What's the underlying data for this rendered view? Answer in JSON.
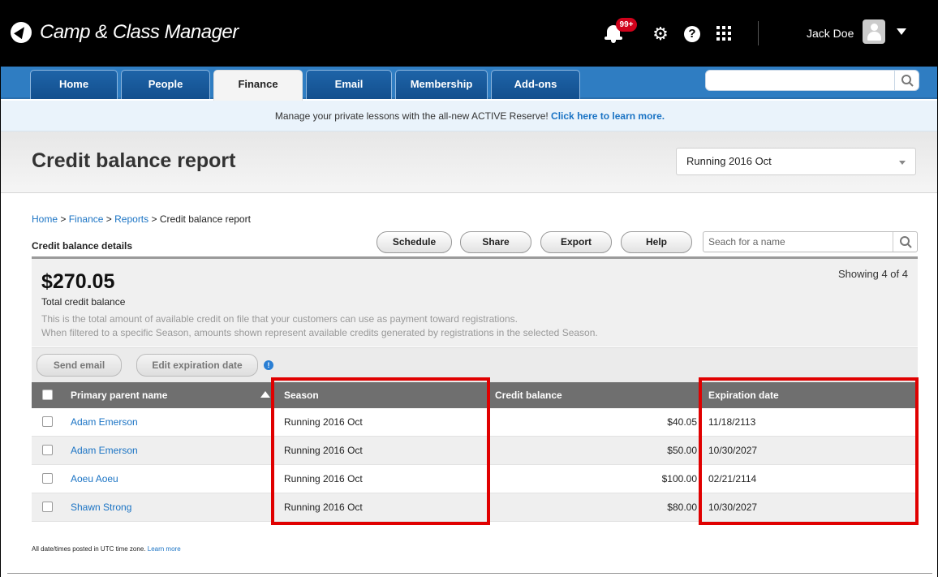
{
  "app": {
    "title": "Camp & Class Manager",
    "notification_badge": "99+",
    "username": "Jack Doe"
  },
  "nav": {
    "tabs": [
      {
        "label": "Home"
      },
      {
        "label": "People"
      },
      {
        "label": "Finance",
        "active": true
      },
      {
        "label": "Email"
      },
      {
        "label": "Membership"
      },
      {
        "label": "Add-ons"
      }
    ],
    "search_value": ""
  },
  "banner": {
    "text": "Manage your private lessons with the all-new ACTIVE Reserve!",
    "link": "Click here to learn more."
  },
  "page": {
    "title": "Credit balance report",
    "season_selected": "Running 2016 Oct"
  },
  "breadcrumb": {
    "home": "Home",
    "finance": "Finance",
    "reports": "Reports",
    "current": "Credit balance report",
    "sep": ">"
  },
  "section": {
    "title": "Credit balance details",
    "buttons": {
      "schedule": "Schedule",
      "share": "Share",
      "export": "Export",
      "help": "Help"
    },
    "search_placeholder": "Seach for a name"
  },
  "summary": {
    "total": "$270.05",
    "total_label": "Total credit balance",
    "desc1": "This is the total amount of available credit on file that your customers can use as payment toward registrations.",
    "desc2": "When filtered to a specific Season, amounts shown represent available credits generated by registrations in the selected Season.",
    "showing": "Showing 4 of 4"
  },
  "actions": {
    "send_email": "Send email",
    "edit_expiration": "Edit expiration date"
  },
  "table": {
    "headers": {
      "name": "Primary parent name",
      "season": "Season",
      "credit": "Credit balance",
      "expiration": "Expiration date"
    },
    "rows": [
      {
        "name": "Adam Emerson",
        "season": "Running 2016 Oct",
        "credit": "$40.05",
        "expiration": "11/18/2113"
      },
      {
        "name": "Adam Emerson",
        "season": "Running 2016 Oct",
        "credit": "$50.00",
        "expiration": "10/30/2027"
      },
      {
        "name": "Aoeu Aoeu",
        "season": "Running 2016 Oct",
        "credit": "$100.00",
        "expiration": "02/21/2114"
      },
      {
        "name": "Shawn Strong",
        "season": "Running 2016 Oct",
        "credit": "$80.00",
        "expiration": "10/30/2027"
      }
    ]
  },
  "footer": {
    "note": "All date/times posted in UTC time zone.",
    "link": "Learn more"
  },
  "colors": {
    "nav_blue": "#2f7dc2",
    "link_blue": "#1a73c4",
    "highlight_red": "#e00000",
    "table_header": "#6f6f6f",
    "badge_red": "#d0021b"
  },
  "icons": [
    "logo-icon",
    "bell-icon",
    "gear-icon",
    "help-icon",
    "apps-grid-icon",
    "user-avatar-icon",
    "chevron-down-icon",
    "search-icon",
    "info-icon",
    "sort-asc-icon"
  ]
}
